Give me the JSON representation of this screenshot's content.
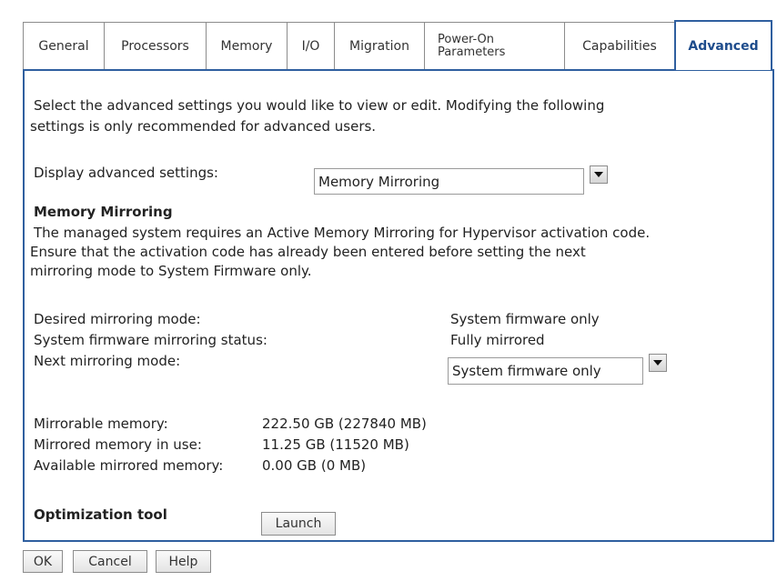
{
  "tabs": [
    {
      "label": "General"
    },
    {
      "label": "Processors"
    },
    {
      "label": "Memory"
    },
    {
      "label": "I/O"
    },
    {
      "label": "Migration"
    },
    {
      "label": "Power-On\nParameters"
    },
    {
      "label": "Capabilities"
    },
    {
      "label": "Advanced",
      "active": true
    }
  ],
  "intro": {
    "line1": "Select the advanced settings you would like to view or edit. Modifying the following",
    "line2": "settings is only recommended for advanced users."
  },
  "display_settings": {
    "label": "Display advanced settings:",
    "selected": "Memory Mirroring"
  },
  "section": {
    "title": "Memory Mirroring",
    "desc_line1": "The managed system requires an Active Memory Mirroring for Hypervisor activation code.",
    "desc_line2": "Ensure that the activation code has already been entered before setting the next",
    "desc_line3": "mirroring mode to System Firmware only."
  },
  "mirroring": {
    "desired_label": "Desired mirroring mode:",
    "desired_value": "System firmware only",
    "status_label": "System firmware mirroring status:",
    "status_value": "Fully mirrored",
    "next_label": "Next mirroring mode:",
    "next_selected": "System firmware only"
  },
  "memory": {
    "mirrorable_label": "Mirrorable memory:",
    "mirrorable_value": "222.50 GB (227840 MB)",
    "in_use_label": "Mirrored memory in use:",
    "in_use_value": "11.25 GB (11520 MB)",
    "available_label": "Available mirrored memory:",
    "available_value": "0.00 GB (0 MB)"
  },
  "optimization": {
    "label": "Optimization tool",
    "button": "Launch"
  },
  "footer": {
    "ok": "OK",
    "cancel": "Cancel",
    "help": "Help"
  }
}
